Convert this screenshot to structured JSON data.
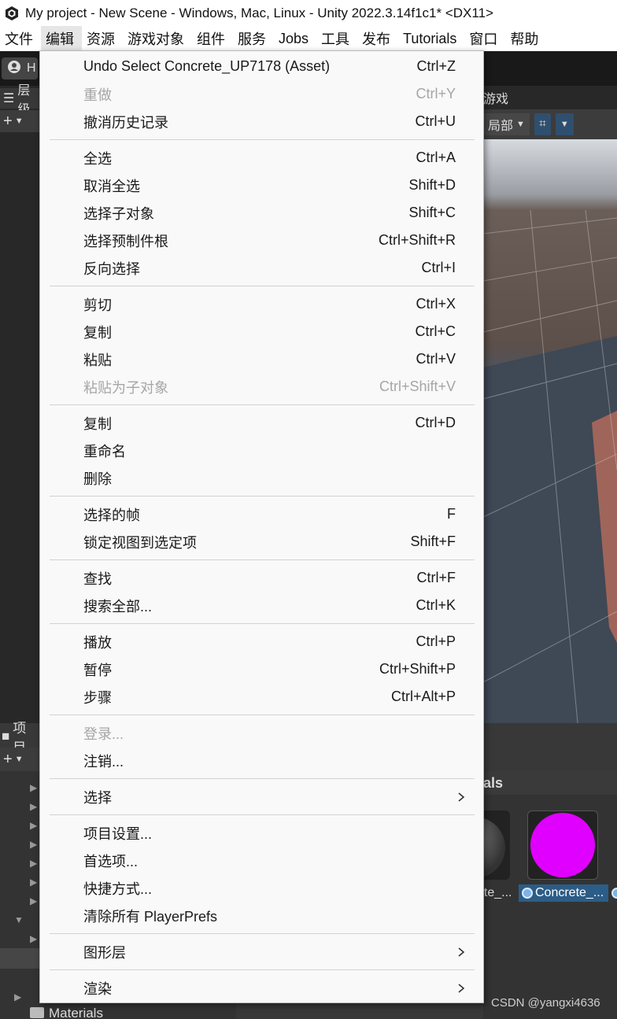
{
  "window": {
    "title": "My project - New Scene - Windows, Mac, Linux - Unity 2022.3.14f1c1* <DX11>"
  },
  "menubar": {
    "items": [
      "文件",
      "编辑",
      "资源",
      "游戏对象",
      "组件",
      "服务",
      "Jobs",
      "工具",
      "发布",
      "Tutorials",
      "窗口",
      "帮助"
    ],
    "active_index": 1
  },
  "background": {
    "account_label": "H",
    "hierarchy_tab": "层级",
    "scene_tab_suffix": "游戏",
    "scene_local_dropdown": "局部",
    "project_tab": "项目",
    "assets_header": "als",
    "asset_1_label": "ete_...",
    "asset_2_label": "Concrete_...",
    "materials_folder": "Materials",
    "watermark": "CSDN @yangxi4636",
    "asset_2_color": "#e000ff"
  },
  "menu": {
    "items": [
      {
        "label": "Undo Select Concrete_UP7178 (Asset)",
        "shortcut": "Ctrl+Z",
        "disabled": false
      },
      {
        "label": "重做",
        "shortcut": "Ctrl+Y",
        "disabled": true
      },
      {
        "label": "撤消历史记录",
        "shortcut": "Ctrl+U",
        "disabled": false
      },
      {
        "label": "全选",
        "shortcut": "Ctrl+A",
        "disabled": false
      },
      {
        "label": "取消全选",
        "shortcut": "Shift+D",
        "disabled": false
      },
      {
        "label": "选择子对象",
        "shortcut": "Shift+C",
        "disabled": false
      },
      {
        "label": "选择预制件根",
        "shortcut": "Ctrl+Shift+R",
        "disabled": false
      },
      {
        "label": "反向选择",
        "shortcut": "Ctrl+I",
        "disabled": false
      },
      {
        "label": "剪切",
        "shortcut": "Ctrl+X",
        "disabled": false
      },
      {
        "label": "复制",
        "shortcut": "Ctrl+C",
        "disabled": false
      },
      {
        "label": "粘贴",
        "shortcut": "Ctrl+V",
        "disabled": false
      },
      {
        "label": "粘贴为子对象",
        "shortcut": "Ctrl+Shift+V",
        "disabled": true
      },
      {
        "label": "复制",
        "shortcut": "Ctrl+D",
        "disabled": false
      },
      {
        "label": "重命名",
        "shortcut": "",
        "disabled": false
      },
      {
        "label": "删除",
        "shortcut": "",
        "disabled": false
      },
      {
        "label": "选择的帧",
        "shortcut": "F",
        "disabled": false
      },
      {
        "label": "锁定视图到选定项",
        "shortcut": "Shift+F",
        "disabled": false
      },
      {
        "label": "查找",
        "shortcut": "Ctrl+F",
        "disabled": false
      },
      {
        "label": "搜索全部...",
        "shortcut": "Ctrl+K",
        "disabled": false
      },
      {
        "label": "播放",
        "shortcut": "Ctrl+P",
        "disabled": false
      },
      {
        "label": "暂停",
        "shortcut": "Ctrl+Shift+P",
        "disabled": false
      },
      {
        "label": "步骤",
        "shortcut": "Ctrl+Alt+P",
        "disabled": false
      },
      {
        "label": "登录...",
        "shortcut": "",
        "disabled": true
      },
      {
        "label": "注销...",
        "shortcut": "",
        "disabled": false
      },
      {
        "label": "选择",
        "shortcut": "",
        "disabled": false,
        "submenu": true
      },
      {
        "label": "项目设置...",
        "shortcut": "",
        "disabled": false
      },
      {
        "label": "首选项...",
        "shortcut": "",
        "disabled": false
      },
      {
        "label": "快捷方式...",
        "shortcut": "",
        "disabled": false
      },
      {
        "label": "清除所有 PlayerPrefs",
        "shortcut": "",
        "disabled": false
      },
      {
        "label": "图形层",
        "shortcut": "",
        "disabled": false,
        "submenu": true
      },
      {
        "label": "渲染",
        "shortcut": "",
        "disabled": false,
        "submenu": true
      }
    ]
  }
}
